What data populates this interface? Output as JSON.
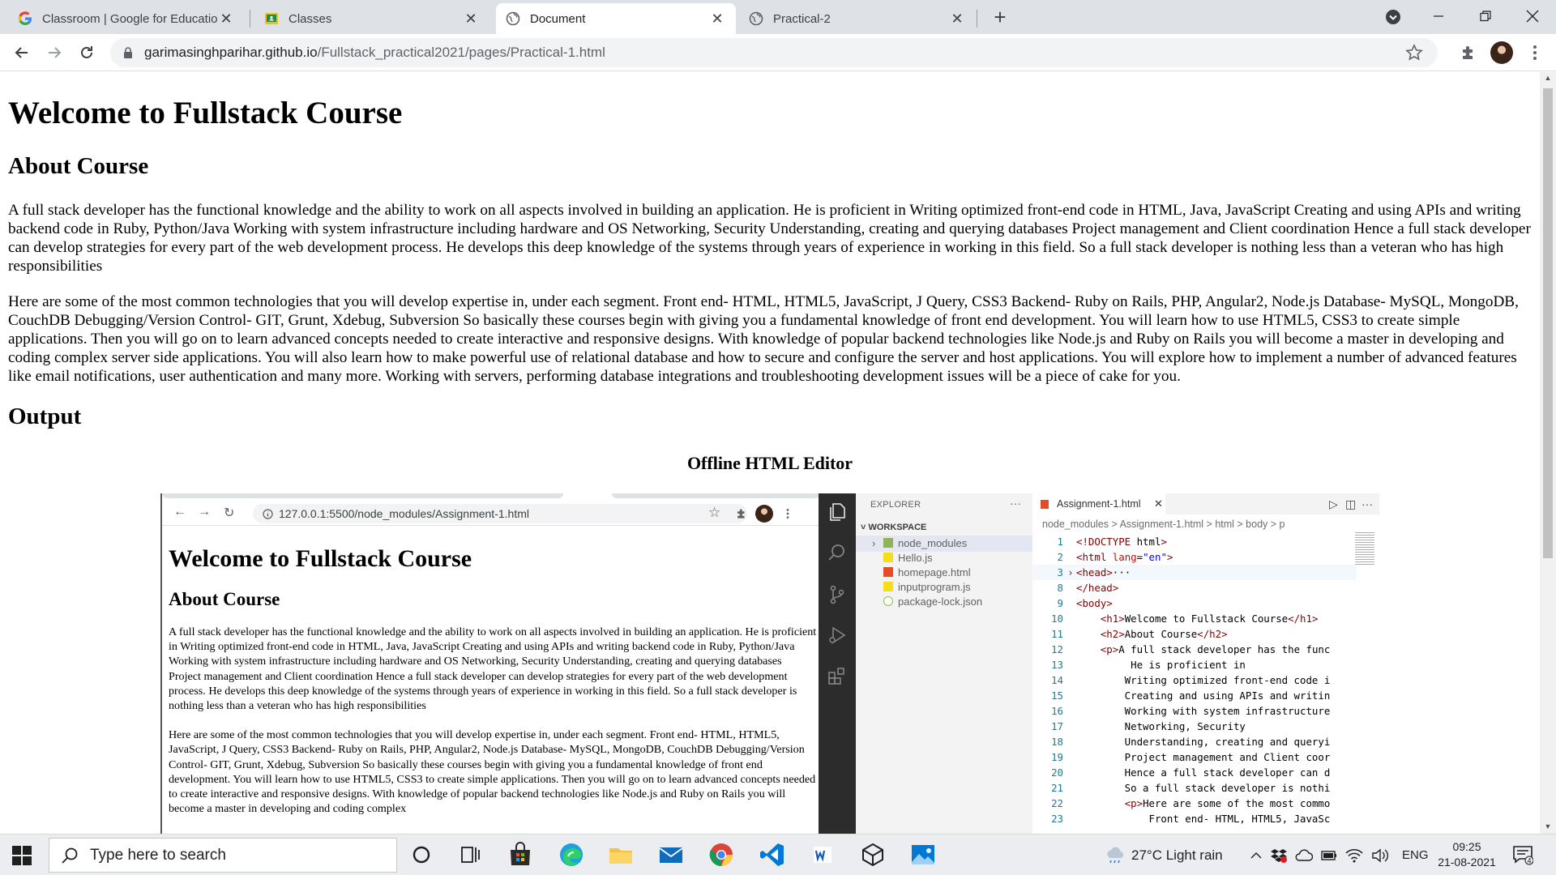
{
  "browser": {
    "tabs": [
      {
        "title": "Classroom | Google for Education",
        "icon": "google-g-icon"
      },
      {
        "title": "Classes",
        "icon": "classroom-icon"
      },
      {
        "title": "Document",
        "icon": "globe-icon",
        "active": true
      },
      {
        "title": "Practical-2",
        "icon": "globe-icon"
      }
    ],
    "url_host": "garimasinghparihar.github.io",
    "url_path": "/Fullstack_practical2021/pages/Practical-1.html"
  },
  "page": {
    "title": "Welcome to Fullstack Course",
    "about_heading": "About Course",
    "paragraph1": "A full stack developer has the functional knowledge and the ability to work on all aspects involved in building an application. He is proficient in Writing optimized front-end code in HTML, Java, JavaScript Creating and using APIs and writing backend code in Ruby, Python/Java Working with system infrastructure including hardware and OS Networking, Security Understanding, creating and querying databases Project management and Client coordination Hence a full stack developer can develop strategies for every part of the web development process. He develops this deep knowledge of the systems through years of experience in working in this field. So a full stack developer is nothing less than a veteran who has high responsibilities",
    "paragraph2": "Here are some of the most common technologies that you will develop expertise in, under each segment. Front end- HTML, HTML5, JavaScript, J Query, CSS3 Backend- Ruby on Rails, PHP, Angular2, Node.js Database- MySQL, MongoDB, CouchDB Debugging/Version Control- GIT, Grunt, Xdebug, Subversion So basically these courses begin with giving you a fundamental knowledge of front end development. You will learn how to use HTML5, CSS3 to create simple applications. Then you will go on to learn advanced concepts needed to create interactive and responsive designs. With knowledge of popular backend technologies like Node.js and Ruby on Rails you will become a master in developing and coding complex server side applications. You will also learn how to make powerful use of relational database and how to secure and configure the server and host applications. You will explore how to implement a number of advanced features like email notifications, user authentication and many more. Working with servers, performing database integrations and troubleshooting development issues will be a piece of cake for you.",
    "output_heading": "Output",
    "image_caption": "Offline HTML Editor"
  },
  "screenshot": {
    "inner_url": "127.0.0.1:5500/node_modules/Assignment-1.html",
    "inner_title": "Welcome to Fullstack Course",
    "inner_about": "About Course",
    "inner_p1": "A full stack developer has the functional knowledge and the ability to work on all aspects involved in building an application. He is proficient in Writing optimized front-end code in HTML, Java, JavaScript Creating and using APIs and writing backend code in Ruby, Python/Java Working with system infrastructure including hardware and OS Networking, Security Understanding, creating and querying databases Project management and Client coordination Hence a full stack developer can develop strategies for every part of the web development process. He develops this deep knowledge of the systems through years of experience in working in this field. So a full stack developer is nothing less than a veteran who has high responsibilities",
    "inner_p2": "Here are some of the most common technologies that you will develop expertise in, under each segment. Front end- HTML, HTML5, JavaScript, J Query, CSS3 Backend- Ruby on Rails, PHP, Angular2, Node.js Database- MySQL, MongoDB, CouchDB Debugging/Version Control- GIT, Grunt, Xdebug, Subversion So basically these courses begin with giving you a fundamental knowledge of front end development. You will learn how to use HTML5, CSS3 to create simple applications. Then you will go on to learn advanced concepts needed to create interactive and responsive designs. With knowledge of popular backend technologies like Node.js and Ruby on Rails you will become a master in developing and coding complex",
    "explorer_title": "EXPLORER",
    "explorer_more": "···",
    "workspace": "WORKSPACE",
    "files": [
      "node_modules",
      "Hello.js",
      "homepage.html",
      "inputprogram.js",
      "package-lock.json"
    ],
    "editor_tab": "Assignment-1.html",
    "breadcrumb": "node_modules > Assignment-1.html > html > body > p",
    "code_lines": [
      {
        "n": "1",
        "t": "<!DOCTYPE html>"
      },
      {
        "n": "2",
        "t": "<html lang=\"en\">"
      },
      {
        "n": "3",
        "t": "<head>···"
      },
      {
        "n": "8",
        "t": "</head>"
      },
      {
        "n": "9",
        "t": "<body>"
      },
      {
        "n": "10",
        "t": "    <h1>Welcome to Fullstack Course</h1>"
      },
      {
        "n": "11",
        "t": "    <h2>About Course</h2>"
      },
      {
        "n": "12",
        "t": "    <p>A full stack developer has the func"
      },
      {
        "n": "13",
        "t": "         He is proficient in"
      },
      {
        "n": "14",
        "t": "        Writing optimized front-end code i"
      },
      {
        "n": "15",
        "t": "        Creating and using APIs and writin"
      },
      {
        "n": "16",
        "t": "        Working with system infrastructure"
      },
      {
        "n": "17",
        "t": "        Networking, Security"
      },
      {
        "n": "18",
        "t": "        Understanding, creating and queryi"
      },
      {
        "n": "19",
        "t": "        Project management and Client coor"
      },
      {
        "n": "20",
        "t": "        Hence a full stack developer can d"
      },
      {
        "n": "21",
        "t": "        So a full stack developer is nothi"
      },
      {
        "n": "22",
        "t": "        <p>Here are some of the most commo"
      },
      {
        "n": "23",
        "t": "            Front end- HTML, HTML5, JavaSc"
      }
    ]
  },
  "taskbar": {
    "search_placeholder": "Type here to search",
    "weather": "27°C  Light rain",
    "lang": "ENG",
    "time": "09:25",
    "date": "21-08-2021",
    "notification_count": "4"
  },
  "colors": {
    "accent_running": "#d31f26",
    "chrome_frame": "#dee1e6",
    "vscode_activity": "#2c2c2c",
    "vscode_linenum": "#237893"
  }
}
